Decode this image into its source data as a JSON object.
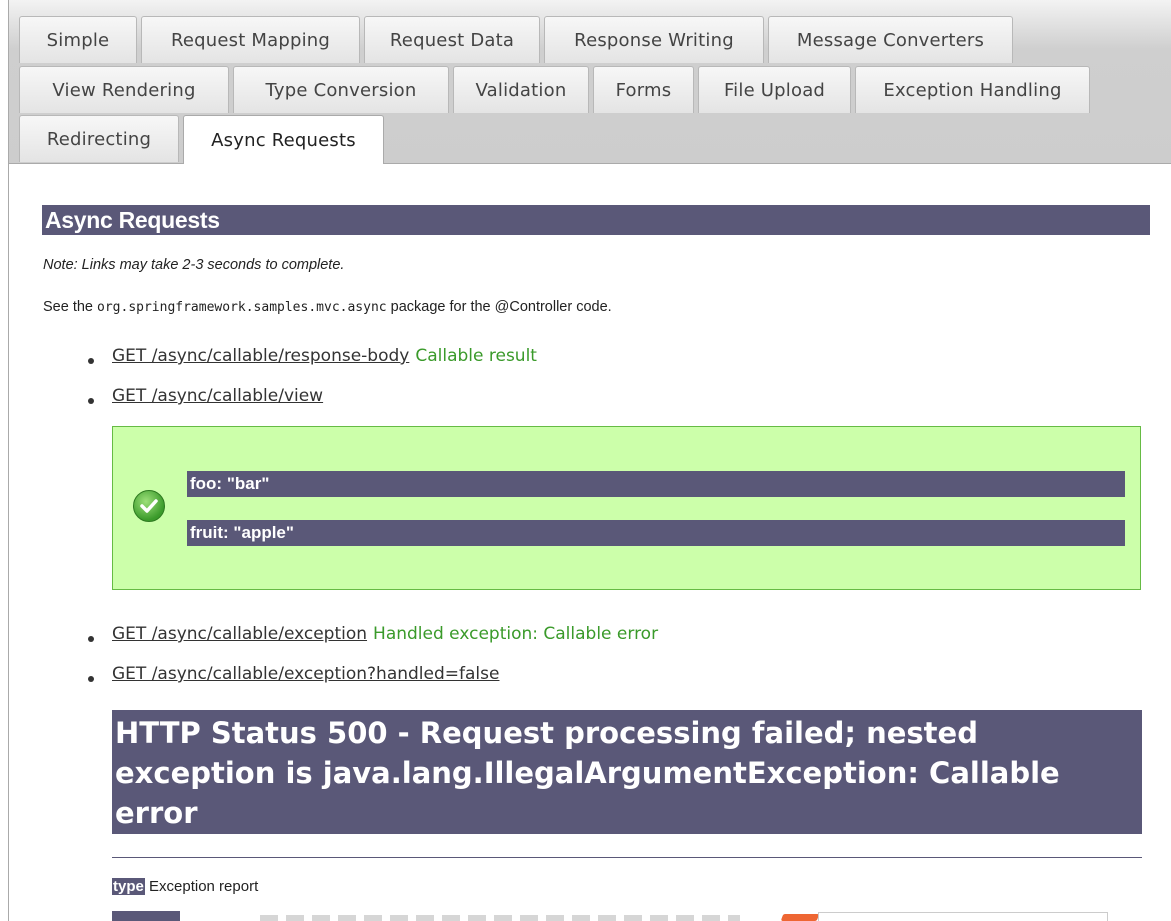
{
  "tabs": {
    "row1": [
      "Simple",
      "Request Mapping",
      "Request Data",
      "Response Writing",
      "Message Converters"
    ],
    "row2": [
      "View Rendering",
      "Type Conversion",
      "Validation",
      "Forms",
      "File Upload",
      "Exception Handling"
    ],
    "row3": [
      "Redirecting",
      "Async Requests"
    ],
    "active": "Async Requests"
  },
  "section": {
    "title": "Async Requests",
    "note": "Note: Links may take 2-3 seconds to complete.",
    "see_prefix": "See the ",
    "see_package": "org.springframework.samples.mvc.async",
    "see_suffix": " package for the @Controller code."
  },
  "links": [
    {
      "text": "GET /async/callable/response-body",
      "result": "Callable result"
    },
    {
      "text": "GET /async/callable/view",
      "result": ""
    },
    {
      "text": "GET /async/callable/exception",
      "result": "Handled exception: Callable error"
    },
    {
      "text": "GET /async/callable/exception?handled=false",
      "result": ""
    }
  ],
  "view_result": {
    "icon": "checkmark-icon",
    "fields": [
      "foo: \"bar\"",
      "fruit: \"apple\""
    ]
  },
  "error": {
    "heading": "HTTP Status 500 - Request processing failed; nested exception is java.lang.IllegalArgumentException: Callable error",
    "type_label": "type",
    "type_value": " Exception report"
  },
  "colors": {
    "header_bar": "#5a5878",
    "success_bg": "#ccffaa",
    "success_text": "#3a9a2a"
  }
}
